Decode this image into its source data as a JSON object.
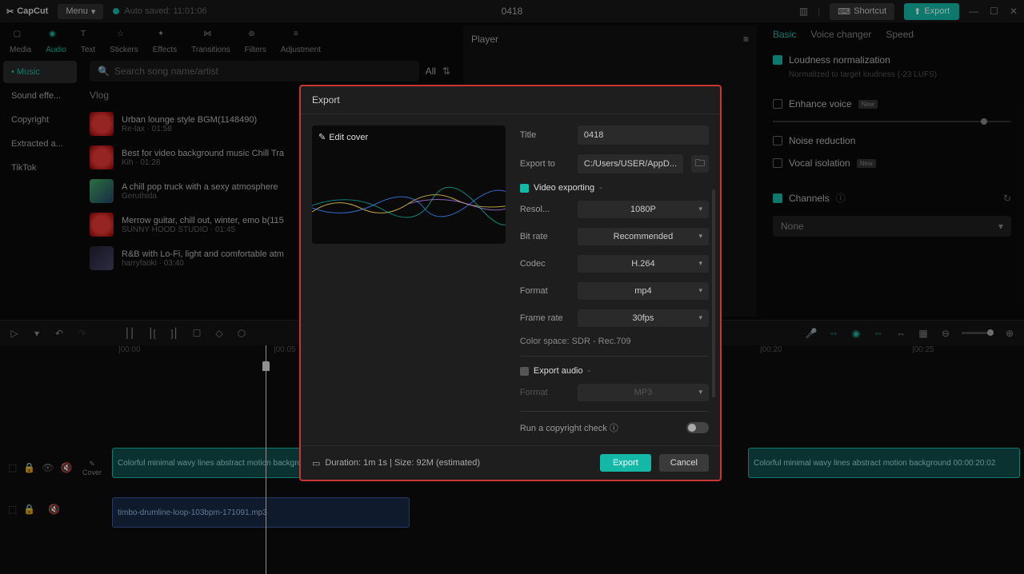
{
  "topbar": {
    "logo": "CapCut",
    "menu": "Menu",
    "autosave": "Auto saved: 11:01:06",
    "project": "0418",
    "shortcut": "Shortcut",
    "export": "Export"
  },
  "nav": {
    "tabs": [
      "Media",
      "Audio",
      "Text",
      "Stickers",
      "Effects",
      "Transitions",
      "Filters",
      "Adjustment"
    ],
    "active": 1
  },
  "audio_sidebar": [
    "Music",
    "Sound effe...",
    "Copyright",
    "Extracted a...",
    "TikTok"
  ],
  "audio": {
    "search_placeholder": "Search song name/artist",
    "all": "All",
    "section": "Vlog",
    "tracks": [
      {
        "title": "Urban lounge style BGM(1148490)",
        "meta": "Re-lax · 01:58"
      },
      {
        "title": "Best for video background music Chill Tra",
        "meta": "Kih · 01:28"
      },
      {
        "title": "A chill pop truck with a sexy atmosphere",
        "meta": "Geruthida"
      },
      {
        "title": "Merrow guitar, chill out, winter, emo b(115",
        "meta": "SUNNY HOOD STUDIO · 01:45"
      },
      {
        "title": "R&B with Lo-Fi, light and comfortable atm",
        "meta": "harryfaoki · 03:40"
      }
    ]
  },
  "player": {
    "title": "Player"
  },
  "right": {
    "tabs": [
      "Basic",
      "Voice changer",
      "Speed"
    ],
    "loudness": "Loudness normalization",
    "loudness_sub": "Normalized to target loudness (-23 LUFS)",
    "enhance": "Enhance voice",
    "noise": "Noise reduction",
    "vocal": "Vocal isolation",
    "channels": "Channels",
    "channels_value": "None"
  },
  "timeline": {
    "marks": [
      "|00:00",
      "|00:05",
      "|00:20",
      "|00:25"
    ],
    "cover": "Cover",
    "video_clip": "Colorful minimal wavy lines abstract motion backgro",
    "video_clip_r": "Colorful minimal wavy lines abstract motion background   00:00:20:02",
    "audio_clip": "timbo-drumline-loop-103bpm-171091.mp3"
  },
  "modal": {
    "title": "Export",
    "edit_cover": "Edit cover",
    "fields": {
      "title_label": "Title",
      "title_value": "0418",
      "exportto_label": "Export to",
      "exportto_value": "C:/Users/USER/AppD...",
      "video_exporting": "Video exporting",
      "resolution_label": "Resol...",
      "resolution_value": "1080P",
      "bitrate_label": "Bit rate",
      "bitrate_value": "Recommended",
      "codec_label": "Codec",
      "codec_value": "H.264",
      "format_label": "Format",
      "format_value": "mp4",
      "framerate_label": "Frame rate",
      "framerate_value": "30fps",
      "colorspace": "Color space: SDR - Rec.709",
      "export_audio": "Export audio",
      "audio_format_label": "Format",
      "audio_format_value": "MP3",
      "copyright": "Run a copyright check"
    },
    "footer_info": "Duration: 1m 1s | Size: 92M (estimated)",
    "export_btn": "Export",
    "cancel_btn": "Cancel"
  }
}
